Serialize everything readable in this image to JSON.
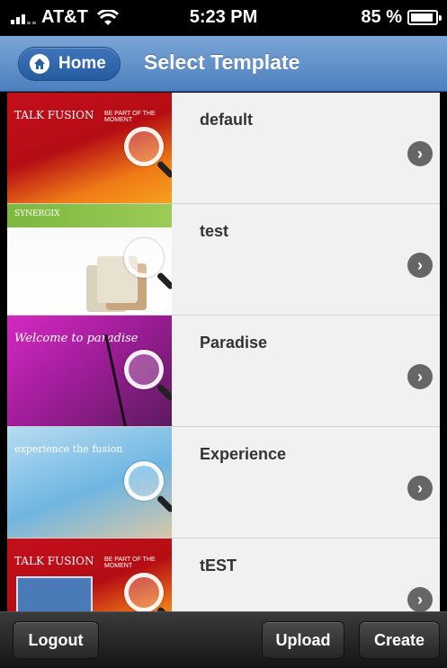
{
  "status_bar": {
    "carrier": "AT&T",
    "time": "5:23 PM",
    "battery": "85 %"
  },
  "header": {
    "home_label": "Home",
    "title": "Select Template"
  },
  "templates": [
    {
      "title": "default",
      "thumb_text": "TALK FUSION",
      "thumb_sub": "BE PART OF THE MOMENT"
    },
    {
      "title": "test",
      "thumb_text": "SYNERGIX"
    },
    {
      "title": "Paradise",
      "thumb_text": "Welcome to paradise"
    },
    {
      "title": "Experience",
      "thumb_text": "experience the fusion"
    },
    {
      "title": "tEST",
      "thumb_text": "TALK FUSION",
      "thumb_sub": "BE PART OF THE MOMENT"
    }
  ],
  "toolbar": {
    "logout_label": "Logout",
    "upload_label": "Upload",
    "create_label": "Create"
  }
}
